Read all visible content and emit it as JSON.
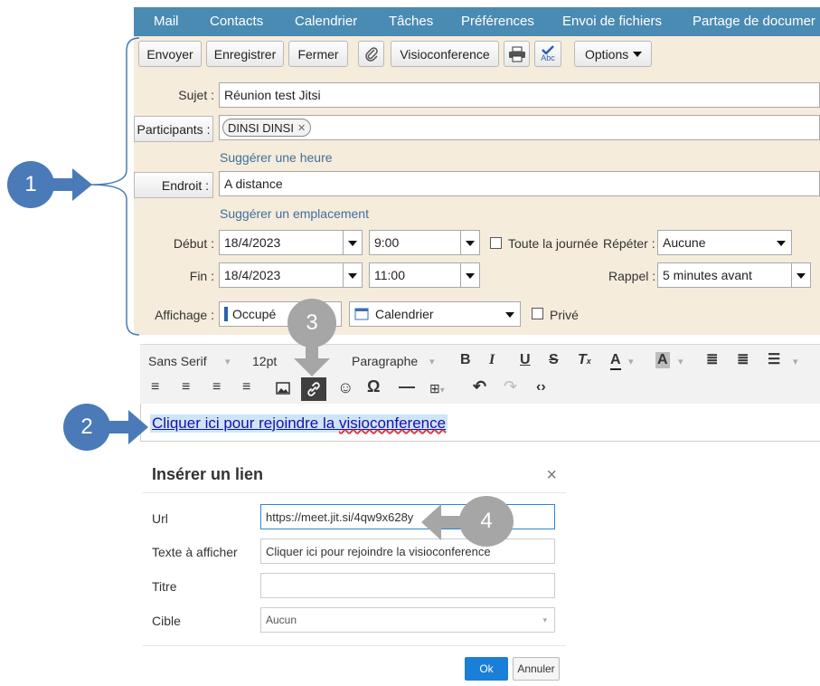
{
  "nav": {
    "items": [
      "Mail",
      "Contacts",
      "Calendrier",
      "Tâches",
      "Préférences",
      "Envoi de fichiers",
      "Partage de documer"
    ]
  },
  "toolbar": {
    "send": "Envoyer",
    "save": "Enregistrer",
    "close": "Fermer",
    "visio": "Visioconference",
    "spell_icon_text": "Abc",
    "options": "Options"
  },
  "form": {
    "subject_label": "Sujet :",
    "subject_value": "Réunion test Jitsi",
    "participants_label": "Participants :",
    "participant_chip": "DINSI DINSI",
    "suggest_time": "Suggérer une heure",
    "location_label": "Endroit :",
    "location_value": "A distance",
    "suggest_location": "Suggérer un emplacement",
    "start_label": "Début :",
    "start_date": "18/4/2023",
    "start_time": "9:00",
    "all_day": "Toute la journée",
    "repeat_label": "Répéter :",
    "repeat_value": "Aucune",
    "end_label": "Fin :",
    "end_date": "18/4/2023",
    "end_time": "11:00",
    "reminder_label": "Rappel :",
    "reminder_value": "5 minutes avant",
    "display_label": "Affichage :",
    "display_value": "Occupé",
    "calendar_value": "Calendrier",
    "private": "Privé"
  },
  "editor": {
    "font": "Sans Serif",
    "size": "12pt",
    "format": "Paragraphe",
    "body_link_main": "Cliquer ici pour rejoindre la ",
    "body_link_misspelled": "visioconference"
  },
  "dialog": {
    "title": "Insérer un lien",
    "close": "×",
    "url_label": "Url",
    "url_value": "https://meet.jit.si/4qw9x628y",
    "text_label": "Texte à afficher",
    "text_value": "Cliquer ici pour rejoindre la visioconference",
    "title_label": "Titre",
    "title_value": "",
    "target_label": "Cible",
    "target_value": "Aucun",
    "ok": "Ok",
    "cancel": "Annuler"
  },
  "callouts": [
    "1",
    "2",
    "3",
    "4"
  ],
  "colors": {
    "nav": "#4a8bb4",
    "form_bg": "#f6ecdb",
    "link": "#3d6fa0",
    "callout_blue": "#4a7ab8",
    "callout_grey": "#a6a6a6",
    "ok_button": "#1a7fd6"
  },
  "icons": [
    "paperclip-icon",
    "printer-icon",
    "spellcheck-icon",
    "chevron-down-icon",
    "calendar-icon",
    "image-icon",
    "link-icon",
    "emoji-icon",
    "omega-icon",
    "horizontal-rule-icon",
    "table-icon",
    "undo-icon",
    "redo-icon",
    "code-icon",
    "close-icon",
    "arrow-right-icon",
    "arrow-down-icon",
    "arrow-left-icon"
  ]
}
